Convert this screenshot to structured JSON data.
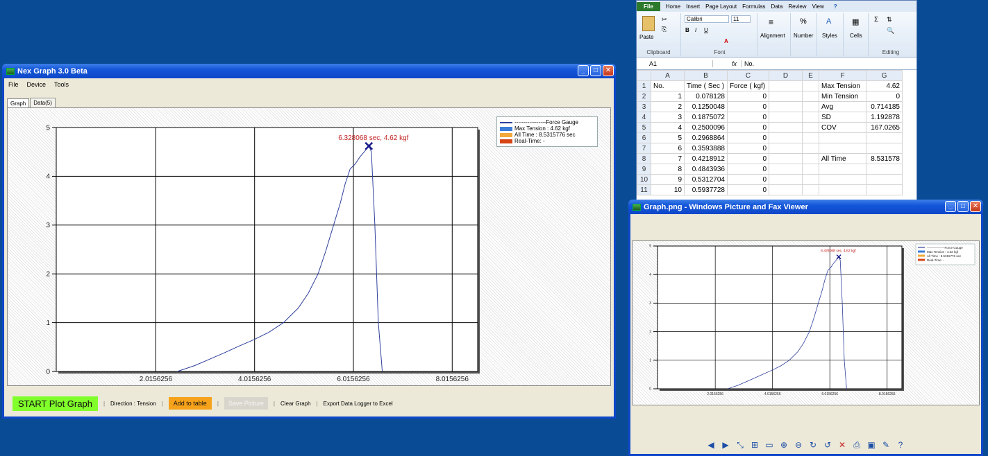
{
  "nex": {
    "title": "Nex Graph 3.0 Beta",
    "menu": [
      "File",
      "Device",
      "Tools"
    ],
    "tabs": [
      "Graph",
      "Data(5)"
    ],
    "legend": {
      "series": "-----------------Force Gauge",
      "max_tension": "Max Tension : 4.62 kgf",
      "all_time": "All Time : 8.5315776 sec",
      "real_time": "Real-Time: -"
    },
    "peak_label": "6.328068 sec, 4.62 kgf",
    "buttons": {
      "start": "START Plot Graph",
      "direction": "Direction : Tension",
      "add": "Add to table",
      "save": "Save Picture",
      "clear": "Clear Graph",
      "export": "Export Data Logger to Excel"
    }
  },
  "colors": {
    "series": "#2e3f9c",
    "max_tension": "#3c7dd8",
    "all_time": "#f2a93a",
    "real_time": "#d64414",
    "peak_marker": "#1a1a8c",
    "peak_text": "#c02020"
  },
  "chart_data": {
    "type": "line",
    "x_ticks": [
      "2.0156256",
      "4.0156256",
      "6.0156256",
      "8.0156256"
    ],
    "x_tick_values": [
      2.0156256,
      4.0156256,
      6.0156256,
      8.0156256
    ],
    "y_ticks": [
      "0",
      "1",
      "2",
      "3",
      "4",
      "5"
    ],
    "xlim": [
      0,
      8.531578
    ],
    "ylim": [
      0,
      5
    ],
    "grid": true,
    "legend_position": "top-right",
    "series": [
      {
        "name": "Force Gauge",
        "x": [
          2.45,
          2.8,
          3.1,
          3.4,
          3.7,
          4.0,
          4.3,
          4.6,
          4.9,
          5.1,
          5.3,
          5.45,
          5.6,
          5.75,
          5.85,
          5.95,
          6.05,
          6.15,
          6.25,
          6.33,
          6.38,
          6.45,
          6.52,
          6.6
        ],
        "y": [
          0.0,
          0.12,
          0.25,
          0.38,
          0.52,
          0.65,
          0.8,
          1.0,
          1.3,
          1.6,
          2.0,
          2.45,
          2.95,
          3.45,
          3.85,
          4.15,
          4.25,
          4.4,
          4.52,
          4.62,
          4.5,
          3.0,
          1.0,
          0.0
        ]
      }
    ],
    "peak": {
      "x": 6.328068,
      "y": 4.62
    }
  },
  "excel": {
    "tabs": [
      "File",
      "Home",
      "Insert",
      "Page Layout",
      "Formulas",
      "Data",
      "Review",
      "View"
    ],
    "font_name": "Calibri",
    "font_size": "11",
    "groups": [
      "Clipboard",
      "Font",
      "Alignment",
      "Number",
      "Styles",
      "Cells",
      "Editing"
    ],
    "paste": "Paste",
    "name_box": "A1",
    "fx": "fx",
    "formula": "No.",
    "columns": [
      "A",
      "B",
      "C",
      "D",
      "E",
      "F",
      "G"
    ],
    "rows": [
      [
        "1",
        "No.",
        "Time ( Sec )",
        "Force ( kgf)",
        "",
        "",
        "Max Tension",
        "4.62"
      ],
      [
        "2",
        "1",
        "0.078128",
        "0",
        "",
        "",
        "Min Tension",
        "0"
      ],
      [
        "3",
        "2",
        "0.1250048",
        "0",
        "",
        "",
        "Avg",
        "0.714185"
      ],
      [
        "4",
        "3",
        "0.1875072",
        "0",
        "",
        "",
        "SD",
        "1.192878"
      ],
      [
        "5",
        "4",
        "0.2500096",
        "0",
        "",
        "",
        "COV",
        "167.0265"
      ],
      [
        "6",
        "5",
        "0.2968864",
        "0",
        "",
        "",
        "",
        ""
      ],
      [
        "7",
        "6",
        "0.3593888",
        "0",
        "",
        "",
        "",
        ""
      ],
      [
        "8",
        "7",
        "0.4218912",
        "0",
        "",
        "",
        "All Time",
        "8.531578"
      ],
      [
        "9",
        "8",
        "0.4843936",
        "0",
        "",
        "",
        "",
        ""
      ],
      [
        "10",
        "9",
        "0.5312704",
        "0",
        "",
        "",
        "",
        ""
      ],
      [
        "11",
        "10",
        "0.5937728",
        "0",
        "",
        "",
        "",
        ""
      ]
    ]
  },
  "viewer": {
    "title": "Graph.png - Windows Picture and Fax Viewer"
  }
}
